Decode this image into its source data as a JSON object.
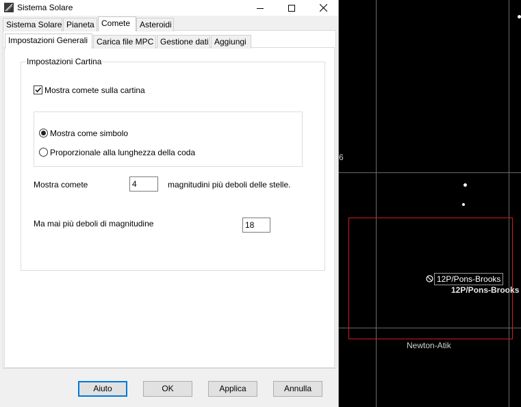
{
  "window": {
    "title": "Sistema Solare",
    "controls": [
      "minimize",
      "maximize",
      "close"
    ]
  },
  "main_tabs": [
    {
      "label": "Sistema Solare",
      "active": false
    },
    {
      "label": "Pianeta",
      "active": false
    },
    {
      "label": "Comete",
      "active": true
    },
    {
      "label": "Asteroidi",
      "active": false
    }
  ],
  "sub_tabs": [
    {
      "label": "Impostazioni Generali",
      "active": true
    },
    {
      "label": "Carica file MPC",
      "active": false
    },
    {
      "label": "Gestione dati",
      "active": false
    },
    {
      "label": "Aggiungi",
      "active": false
    }
  ],
  "map_settings": {
    "group_title": "Impostazioni Cartina",
    "show_comets_label": "Mostra comete sulla cartina",
    "show_comets_checked": true,
    "display_mode": {
      "options": [
        "Mostra come simbolo",
        "Proporzionale alla lunghezza della coda"
      ],
      "selected": "Mostra come simbolo"
    },
    "show_comets_prefix": "Mostra comete",
    "magnitudes_fainter_value": "4",
    "magnitudes_fainter_suffix": "magnitudini più deboli delle stelle.",
    "never_fainter_label": "Ma mai più deboli di magnitudine",
    "never_fainter_value": "18"
  },
  "buttons": {
    "help": "Aiuto",
    "ok": "OK",
    "apply": "Applica",
    "cancel": "Annulla"
  },
  "sky_map": {
    "partial_label": "6",
    "comet_label_boxed": "12P/Pons-Brooks",
    "comet_label": "12P/Pons-Brooks",
    "telescope_label": "Newton-Atik",
    "frame_color": "#d81c1c"
  }
}
